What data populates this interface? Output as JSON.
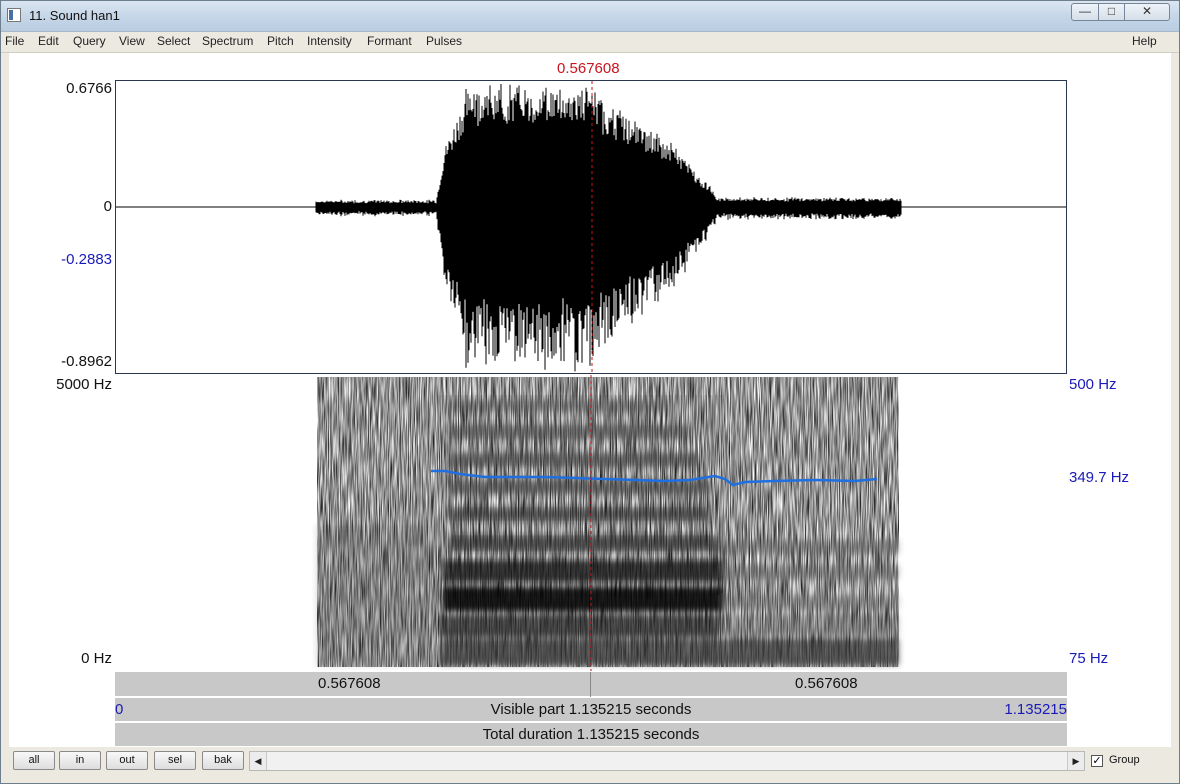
{
  "window": {
    "title": "11. Sound han1",
    "minimize_glyph": "—",
    "maximize_glyph": "□",
    "close_glyph": "✕"
  },
  "menu": {
    "items": [
      "File",
      "Edit",
      "Query",
      "View",
      "Select",
      "Spectrum",
      "Pitch",
      "Intensity",
      "Formant",
      "Pulses"
    ],
    "help": "Help"
  },
  "cursor": {
    "time": "0.567608"
  },
  "waveform": {
    "y_max": "0.6766",
    "y_zero": "0",
    "y_cursor": "-0.2883",
    "y_min": "-0.8962"
  },
  "spectrogram": {
    "freq_top": "5000 Hz",
    "freq_bottom": "0 Hz",
    "pitch_top": "500 Hz",
    "pitch_cursor": "349.7 Hz",
    "pitch_bottom": "75 Hz",
    "pitch_color": "#1f6fe0"
  },
  "time_bar": {
    "left_value": "0.567608",
    "right_value": "0.567608"
  },
  "visible_bar": {
    "start": "0",
    "label": "Visible part 1.135215 seconds",
    "end": "1.135215"
  },
  "total_bar": {
    "label": "Total duration 1.135215 seconds"
  },
  "nav_buttons": {
    "all": "all",
    "in": "in",
    "out": "out",
    "sel": "sel",
    "bak": "bak"
  },
  "group": {
    "label": "Group",
    "checked": true,
    "check_glyph": "✓"
  },
  "scroll": {
    "left_glyph": "◀",
    "right_glyph": "▶"
  },
  "icons": [
    "app-icon",
    "check-icon",
    "scroll-left-arrow-icon",
    "scroll-right-arrow-icon"
  ]
}
